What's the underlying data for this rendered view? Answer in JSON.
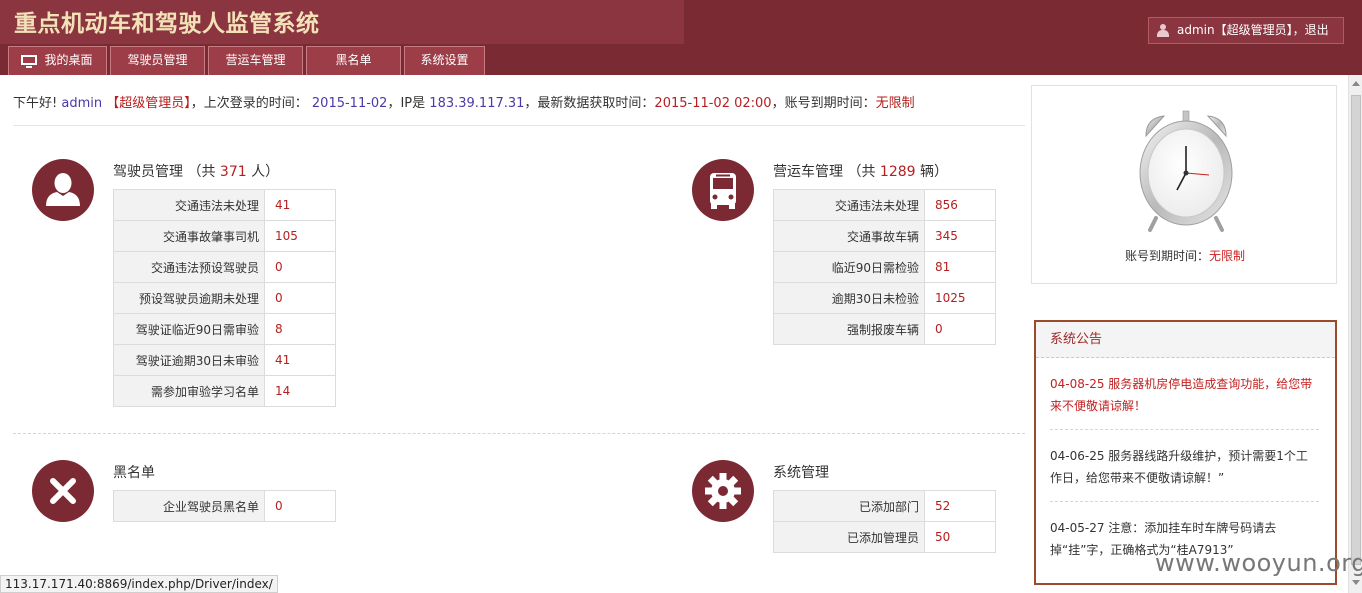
{
  "header": {
    "app_title": "重点机动车和驾驶人监管系统",
    "user_label": "admin【超级管理员】，退出"
  },
  "nav": {
    "tabs": [
      "我的桌面",
      "驾驶员管理",
      "营运车管理",
      "黑名单",
      "系统设置"
    ]
  },
  "welcome": {
    "greeting": "下午好!",
    "username": "admin",
    "role": "【超级管理员】",
    "last_login_label": "，上次登录的时间：",
    "last_login": "2015-11-02",
    "ip_label": "，IP是",
    "ip": "183.39.117.31",
    "fetch_label": "，最新数据获取时间：",
    "fetch_time": "2015-11-02 02:00",
    "expire_label": "，账号到期时间：",
    "expire_value": "无限制"
  },
  "drivers": {
    "title": "驾驶员管理",
    "count_prefix": "（共",
    "count": "371",
    "count_suffix": "人）",
    "rows": [
      {
        "label": "交通违法未处理",
        "value": "41"
      },
      {
        "label": "交通事故肇事司机",
        "value": "105"
      },
      {
        "label": "交通违法预设驾驶员",
        "value": "0"
      },
      {
        "label": "预设驾驶员逾期未处理",
        "value": "0"
      },
      {
        "label": "驾驶证临近90日需审验",
        "value": "8"
      },
      {
        "label": "驾驶证逾期30日未审验",
        "value": "41"
      },
      {
        "label": "需参加审验学习名单",
        "value": "14"
      }
    ]
  },
  "vehicles": {
    "title": "营运车管理",
    "count_prefix": "（共",
    "count": "1289",
    "count_suffix": "辆）",
    "rows": [
      {
        "label": "交通违法未处理",
        "value": "856"
      },
      {
        "label": "交通事故车辆",
        "value": "345"
      },
      {
        "label": "临近90日需检验",
        "value": "81"
      },
      {
        "label": "逾期30日未检验",
        "value": "1025"
      },
      {
        "label": "强制报废车辆",
        "value": "0"
      }
    ]
  },
  "blacklist": {
    "title": "黑名单",
    "rows": [
      {
        "label": "企业驾驶员黑名单",
        "value": "0"
      }
    ]
  },
  "system": {
    "title": "系统管理",
    "rows": [
      {
        "label": "已添加部门",
        "value": "52"
      },
      {
        "label": "已添加管理员",
        "value": "50"
      }
    ]
  },
  "clock_panel": {
    "expire_label": "账号到期时间：",
    "expire_value": "无限制"
  },
  "notice": {
    "title": "系统公告",
    "items": [
      "04-08-25 服务器机房停电造成查询功能，给您带来不便敬请谅解！",
      "04-06-25 服务器线路升级维护，预计需要1个工作日，给您带来不便敬请谅解！”",
      "04-05-27 注意：添加挂车时车牌号码请去掉“挂”字，正确格式为“桂A7913”"
    ]
  },
  "status_url": "113.17.171.40:8869/index.php/Driver/index/",
  "watermark": "www.wooyun.org",
  "colors": {
    "header_bg": "#7a2a33",
    "accent_red": "#b51f1f",
    "link_blue": "#4a3aa8",
    "icon_bg": "#7b2a33"
  },
  "icons": [
    "user-icon",
    "monitor-icon",
    "person-icon",
    "bus-icon",
    "close-icon",
    "gear-icon",
    "alarm-clock-icon"
  ]
}
